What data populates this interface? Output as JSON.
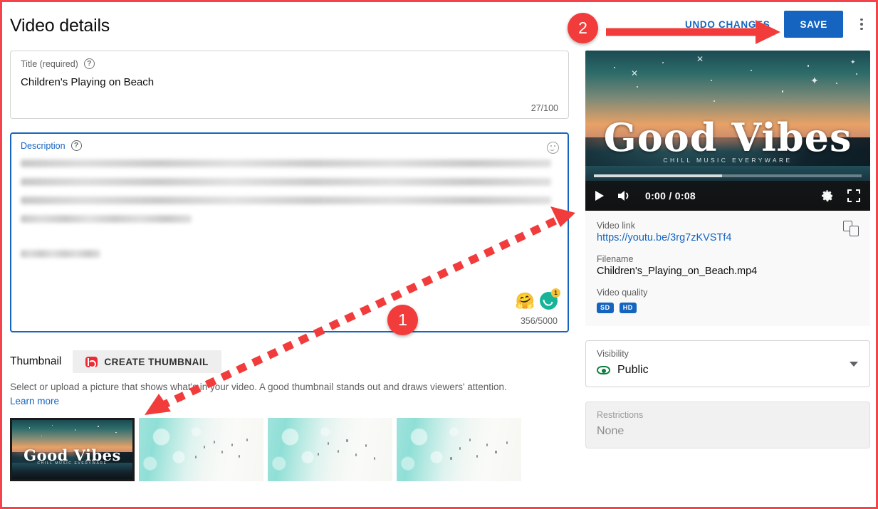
{
  "header": {
    "title": "Video details",
    "undo_label": "UNDO CHANGES",
    "save_label": "SAVE",
    "menu_icon": "kebab-menu-icon"
  },
  "title_field": {
    "label": "Title (required)",
    "value": "Children's Playing on Beach",
    "counter": "27/100",
    "help_icon": "help-circle-icon"
  },
  "description_field": {
    "label": "Description",
    "counter": "356/5000",
    "help_icon": "help-circle-icon",
    "emoji_picker_icon": "emoji-smiley-icon",
    "hug_emoji": "🤗",
    "moon_badge_count": "1",
    "body_redacted": true
  },
  "thumbnail": {
    "section_title": "Thumbnail",
    "create_button": "CREATE THUMBNAIL",
    "create_button_icon": "tubebuddy-logo-icon",
    "description": "Select or upload a picture that shows what's in your video. A good thumbnail stands out and draws viewers' attention.",
    "learn_more": "Learn more",
    "options": [
      {
        "name": "custom-thumbnail",
        "selected": true,
        "overlay_title": "Good Vibes",
        "overlay_sub": "CHILL MUSIC EVERYWARE"
      },
      {
        "name": "auto-frame-1",
        "selected": false,
        "overlay_title": "",
        "overlay_sub": ""
      },
      {
        "name": "auto-frame-2",
        "selected": false,
        "overlay_title": "",
        "overlay_sub": ""
      },
      {
        "name": "auto-frame-3",
        "selected": false,
        "overlay_title": "",
        "overlay_sub": ""
      }
    ]
  },
  "player": {
    "overlay_title": "Good Vibes",
    "overlay_sub": "CHILL MUSIC EVERYWARE",
    "time": "0:00 / 0:08",
    "progress_percent": 48,
    "play_icon": "play-icon",
    "volume_icon": "volume-icon",
    "settings_icon": "gear-icon",
    "fullscreen_icon": "fullscreen-icon"
  },
  "video_info": {
    "link_label": "Video link",
    "link_value": "https://youtu.be/3rg7zKVSTf4",
    "copy_icon": "copy-icon",
    "filename_label": "Filename",
    "filename_value": "Children's_Playing_on_Beach.mp4",
    "quality_label": "Video quality",
    "quality_badges": [
      "SD",
      "HD"
    ]
  },
  "visibility": {
    "label": "Visibility",
    "value": "Public",
    "icon": "eye-public-icon",
    "chevron_icon": "chevron-down-icon"
  },
  "restrictions": {
    "label": "Restrictions",
    "value": "None"
  },
  "annotations": {
    "marker_1": "1",
    "marker_2": "2",
    "accent_color": "#f23b3b",
    "border_color": "#f4434a"
  },
  "colors": {
    "primary_blue": "#1565c0",
    "link_blue": "#1565c0",
    "public_green": "#0a8040",
    "moon_teal": "#16b498"
  }
}
